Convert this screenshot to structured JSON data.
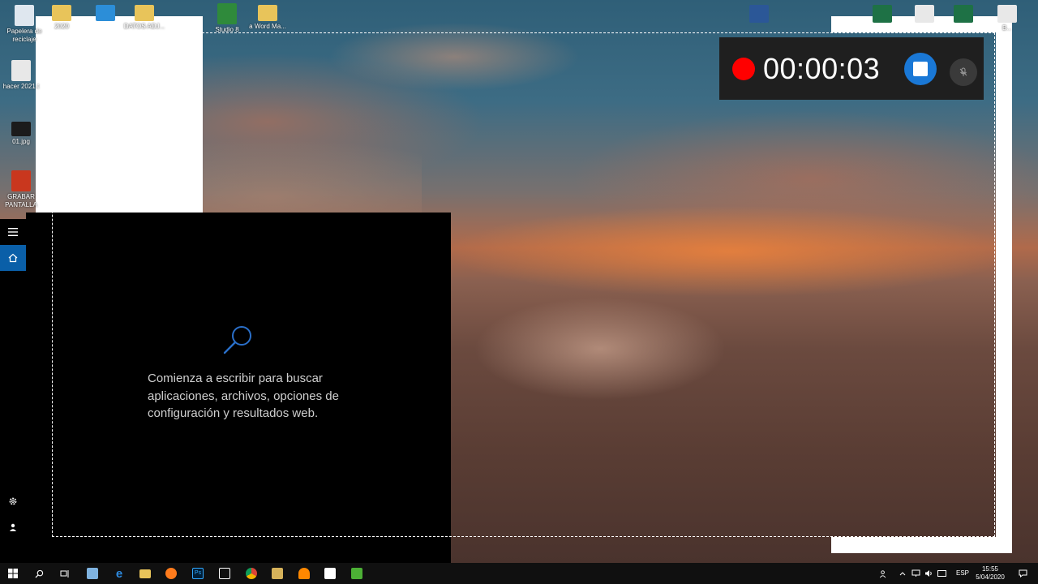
{
  "desktop": {
    "icons_left": [
      {
        "label": "Papelera de reciclaje",
        "icon": "recycle-bin-icon"
      },
      {
        "label": "hacer 2021.t",
        "icon": "document-icon"
      },
      {
        "label": "01.jpg",
        "icon": "image-file-icon"
      },
      {
        "label": "GRABAR PANTALLA",
        "icon": "video-file-icon"
      }
    ],
    "icons_top": [
      {
        "label": "2020",
        "icon": "folder-icon"
      },
      {
        "label": "DATOS ADJ...",
        "icon": "folder-icon"
      },
      {
        "label": "Studio 8",
        "icon": "camtasia-icon"
      },
      {
        "label": "a Word Ma...",
        "icon": "folder-icon"
      },
      {
        "label": "",
        "icon": "word-document-icon"
      },
      {
        "label": "",
        "icon": "excel-document-icon"
      },
      {
        "label": "",
        "icon": "text-document-icon"
      },
      {
        "label": "",
        "icon": "excel-document-icon"
      },
      {
        "label": "B...",
        "icon": "file-icon"
      }
    ]
  },
  "start_rail": {
    "items": [
      {
        "icon": "hamburger-menu-icon"
      },
      {
        "icon": "home-icon",
        "active": true
      },
      {
        "icon": "gear-icon"
      },
      {
        "icon": "user-icon"
      }
    ]
  },
  "search_panel": {
    "hint": "Comienza a escribir para buscar aplicaciones, archivos, opciones de configuración y resultados web.",
    "icon": "search-icon"
  },
  "recorder": {
    "elapsed": "00:00:03",
    "colors": {
      "record": "#ff0000",
      "stop": "#1a78d6"
    }
  },
  "taskbar": {
    "apps": [
      {
        "icon": "windows-start-icon"
      },
      {
        "icon": "search-icon"
      },
      {
        "icon": "task-view-icon"
      },
      {
        "icon": "app-pin-icon"
      },
      {
        "icon": "edge-icon"
      },
      {
        "icon": "file-explorer-icon"
      },
      {
        "icon": "firefox-icon"
      },
      {
        "icon": "photoshop-icon"
      },
      {
        "icon": "screen-app-icon"
      },
      {
        "icon": "chrome-icon"
      },
      {
        "icon": "media-player-icon"
      },
      {
        "icon": "vlc-icon"
      },
      {
        "icon": "camtasia-icon"
      },
      {
        "icon": "camtasia-recorder-icon"
      }
    ],
    "tray": {
      "language": "ESP",
      "time": "15:55",
      "date": "5/04/2020"
    }
  }
}
